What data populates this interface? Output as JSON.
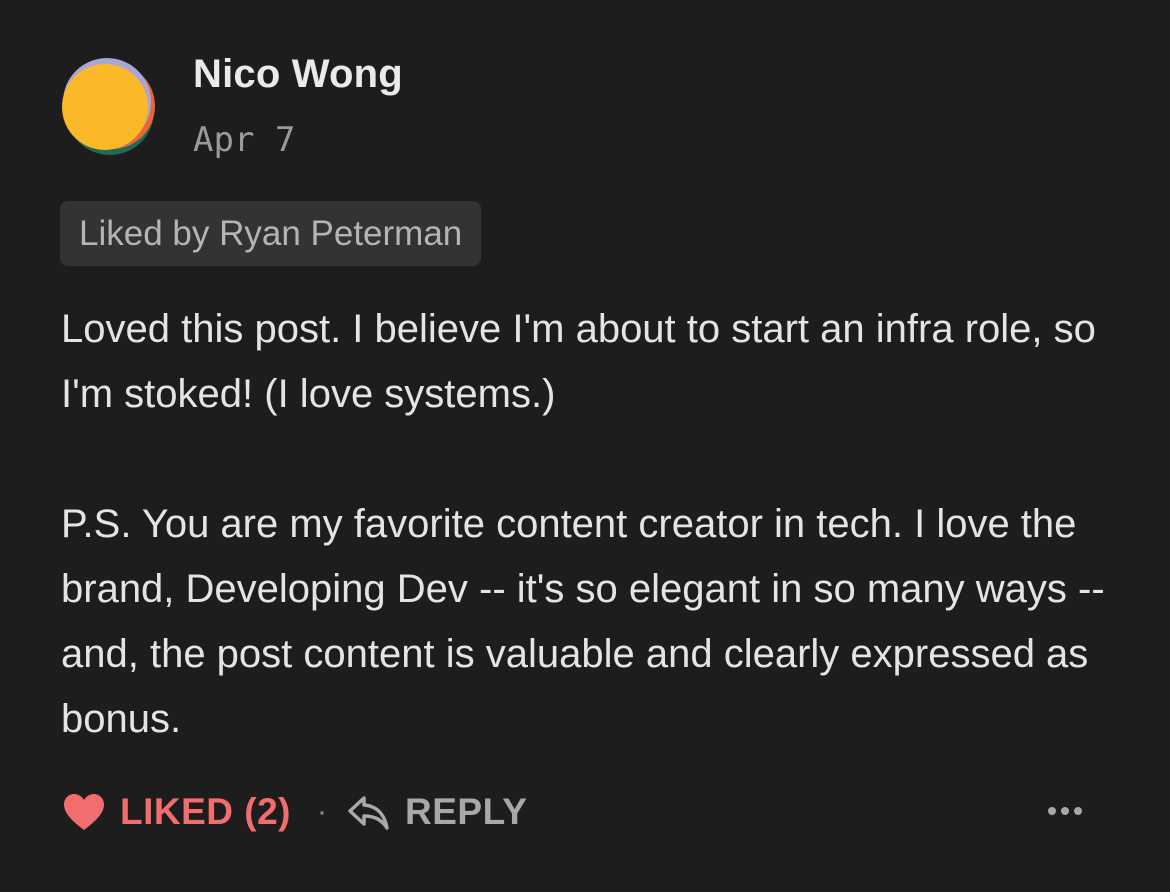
{
  "comment": {
    "author": {
      "name": "Nico Wong",
      "avatar": "avatar-icon"
    },
    "date": "Apr 7",
    "liked_by_label": "Liked by Ryan Peterman",
    "body": [
      "Loved this post. I believe I'm about to start an infra role, so I'm stoked! (I love systems.)",
      "P.S. You are my favorite content creator in tech. I love the brand, Developing Dev -- it's so elegant in so many ways -- and, the post content is valuable and clearly expressed as bonus."
    ],
    "actions": {
      "like_label": "LIKED (2)",
      "like_icon": "heart-icon",
      "separator": "·",
      "reply_label": "REPLY",
      "reply_icon": "reply-icon",
      "more_icon": "more-icon"
    }
  },
  "colors": {
    "background": "#1d1d1d",
    "text": "#e4e4e4",
    "muted": "#9a9a9a",
    "pill": "#333333",
    "liked": "#f26d6d"
  }
}
